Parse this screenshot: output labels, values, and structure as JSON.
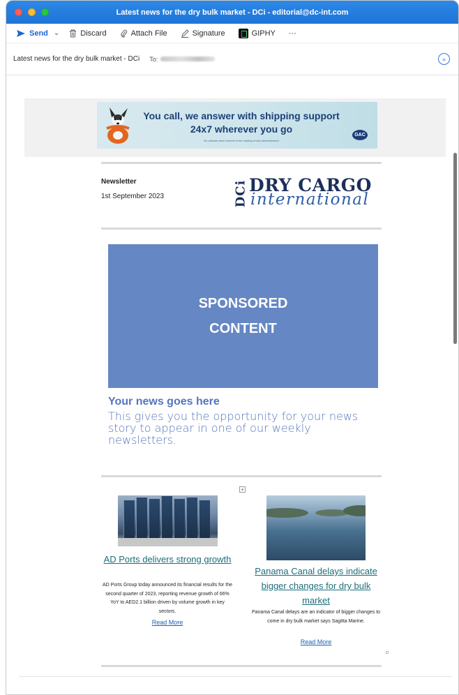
{
  "window": {
    "title": "Latest news for the dry bulk market - DCi - editorial@dc-int.com"
  },
  "toolbar": {
    "send_label": "Send",
    "discard_label": "Discard",
    "attach_label": "Attach File",
    "signature_label": "Signature",
    "giphy_label": "GIPHY",
    "more_label": "···"
  },
  "compose": {
    "subject": "Latest news for the dry bulk market - DCi",
    "to_label": "To:"
  },
  "email": {
    "ad": {
      "line1": "You call, we answer with shipping support",
      "line2": "24x7 wherever you go",
      "disclaimer": "No animals were harmed in the making of this advertisement",
      "brand": "GAC"
    },
    "newsletter_label": "Newsletter",
    "newsletter_date": "1st September 2023",
    "logo": {
      "dci": "DCi",
      "top": "DRY CARGO",
      "bottom": "international"
    },
    "sponsored": {
      "line1": "SPONSORED",
      "line2": "CONTENT"
    },
    "your_news": {
      "title": "Your news goes here",
      "body": "This gives you the opportunity for your news story to appear in one of our weekly newsletters."
    },
    "stories": [
      {
        "title": "AD Ports delivers strong growth",
        "body": "AD Ports Group today announced its financial results for the second quarter of 2023, reporting revenue growth of 66% YoY to AED2.1 billion driven by volume growth in key sectors.",
        "read_more": "Read More"
      },
      {
        "title": "Panama Canal delays indicate bigger changes for dry bulk market",
        "body": "Panama Canal delays are an indicator of bigger changes to come in dry bulk market says Sagitta Marine.",
        "read_more": "Read More"
      }
    ]
  },
  "colors": {
    "titlebar": "#1e74d6",
    "sponsored_bg": "#6587c4",
    "story_link": "#1b6e7a",
    "read_more": "#1a5fb0"
  }
}
